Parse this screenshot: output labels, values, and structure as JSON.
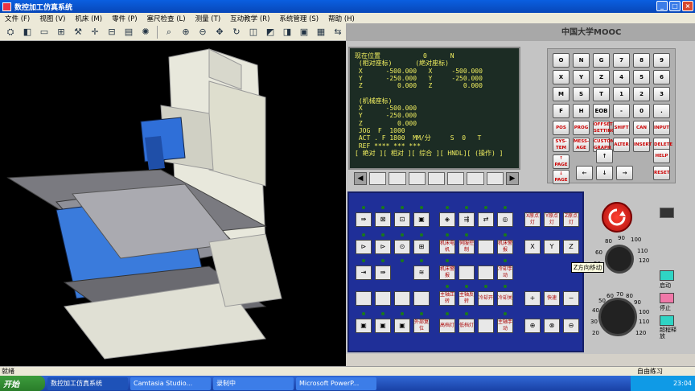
{
  "window": {
    "title": "数控加工仿真系统"
  },
  "menu": [
    "文件 (F)",
    "视图 (V)",
    "机床 (M)",
    "零件 (P)",
    "塞尺检查 (L)",
    "测量 (T)",
    "互动教学 (R)",
    "系统管理 (S)",
    "帮助 (H)"
  ],
  "toolbar_icons": [
    "machine-icon",
    "part-icon",
    "blank-icon",
    "fixture-icon",
    "tool-icon",
    "coordinate-icon",
    "measure-icon",
    "edit-icon",
    "zoom-icon",
    "zoom-in-icon",
    "zoom-out-icon",
    "pan-icon",
    "rotate-icon",
    "front-view-icon",
    "top-view-icon",
    "side-view-icon",
    "iso-view-icon",
    "display-icon",
    "swap-icon"
  ],
  "brand": {
    "mooc": "中国大学MOOC"
  },
  "crt": {
    "text": "现在位置           0      N\n (相对座标)      (絶对座标)\n X      -500.000   X     -500.000\n Y      -250.000   Y     -250.000\n Z         0.000   Z        0.000\n\n (机械座标)\n X      -500.000\n Y      -250.000\n Z         0.000\n JOG  F  1000\n ACT . F 1800  MM/分     S  0   T\n REF **** *** ***\n[ 絶对 ][ 相对 ][ 综合 ][ HNDL][ (操作) ]"
  },
  "mdi_keys": [
    [
      "O",
      "N",
      "G",
      "7",
      "8",
      "9"
    ],
    [
      "X",
      "Y",
      "Z",
      "4",
      "5",
      "6"
    ],
    [
      "M",
      "S",
      "T",
      "1",
      "2",
      "3"
    ],
    [
      "F",
      "H",
      "EOB",
      "-",
      "0",
      "."
    ],
    [
      "POS",
      "PROG",
      "OFFSET SETTING",
      "SHIFT",
      "CAN",
      "INPUT"
    ],
    [
      "SYS-TEM",
      "MESS-AGE",
      "CUSTOM GRAPH",
      "ALTER",
      "INSERT",
      "DELETE"
    ]
  ],
  "mdi_nav": {
    "page_up": "↑ PAGE",
    "page_down": "↓ PAGE",
    "help": "HELP",
    "reset": "RESET",
    "up": "↑",
    "down": "↓",
    "left": "←",
    "right": "→"
  },
  "control_panel": {
    "row1_labels": [
      "X原点灯",
      "Y原点灯",
      "Z原点灯"
    ],
    "row2_labels": [
      "机床电机",
      "伺服控制",
      "",
      "机床警报",
      "X",
      "Y",
      "Z"
    ],
    "row3_labels": [
      "机床警报",
      "",
      "",
      "冷却手动"
    ],
    "row4_labels": [
      "主轴正转",
      "主轴反转",
      "冷却开",
      "冷却关",
      "+",
      "快速",
      "−"
    ],
    "row5_labels": [
      "外部复位",
      "高档灯",
      "低档灯",
      "",
      "主轴手动"
    ]
  },
  "tooltip": "Z方向移动",
  "side_buttons": [
    {
      "label": "启动",
      "color": "#2fd4c4"
    },
    {
      "label": "停止",
      "color": "#f078a8"
    },
    {
      "label": "超程释放",
      "color": "#2fd4c4"
    }
  ],
  "dial_top": [
    "80",
    "90",
    "100",
    "110",
    "120",
    "60",
    "50"
  ],
  "dial_bottom": [
    "50",
    "60",
    "70",
    "80",
    "90",
    "100",
    "110",
    "120",
    "40",
    "30",
    "20"
  ],
  "status": {
    "left": "就绪",
    "right": "自由练习"
  },
  "taskbar": {
    "start": "开始",
    "tasks": [
      "数控加工仿真系统",
      "Camtasia Studio...",
      "录制中",
      "Microsoft PowerP..."
    ],
    "clock": "23:04"
  }
}
